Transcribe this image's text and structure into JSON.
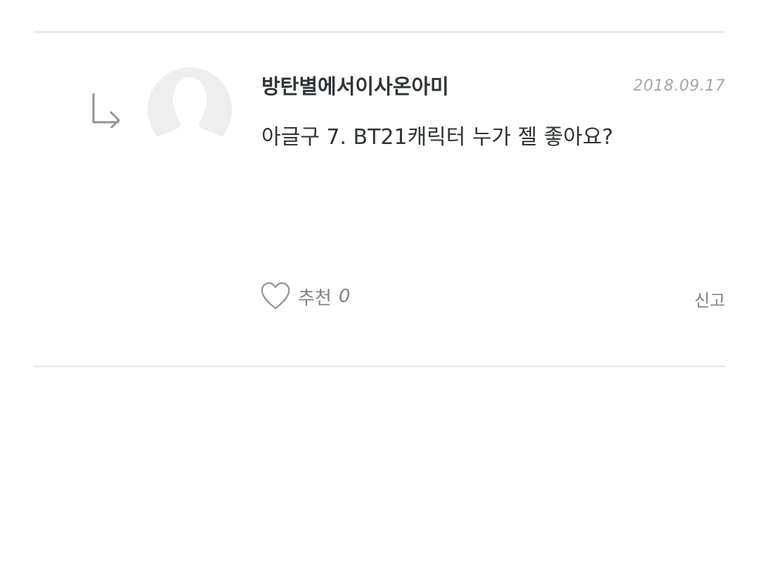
{
  "comment": {
    "author": "방탄별에서이사온아미",
    "date": "2018.09.17",
    "text": "아글구 7. BT21캐릭터 누가 젤 좋아요?",
    "like_label": "추천",
    "like_count": "0",
    "report_label": "신고"
  },
  "icons": {
    "reply": "reply-arrow-icon",
    "avatar": "default-avatar-icon",
    "like": "heart-icon"
  },
  "colors": {
    "divider": "#e8ecea",
    "text": "#2f3437",
    "muted": "#7d8583",
    "date": "#a3aaa7",
    "avatar_bg": "#eeeeee"
  }
}
